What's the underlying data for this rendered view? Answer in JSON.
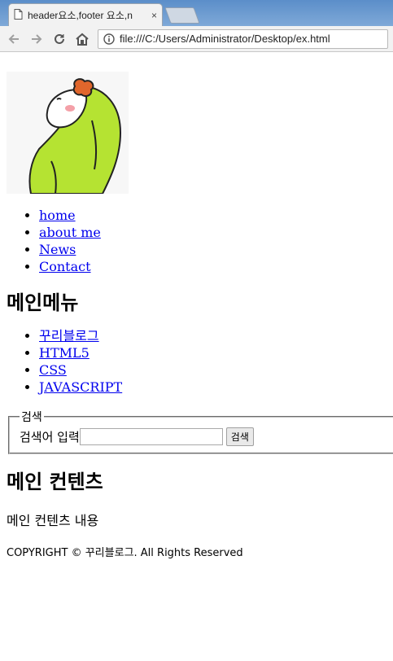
{
  "browser": {
    "tab_title": "header요소,footer 요소,n",
    "tab_close": "×",
    "url": "file:///C:/Users/Administrator/Desktop/ex.html"
  },
  "header": {
    "nav": [
      {
        "label": "home"
      },
      {
        "label": "about me"
      },
      {
        "label": "News"
      },
      {
        "label": "Contact"
      }
    ]
  },
  "aside": {
    "title": "메인메뉴",
    "menu": [
      {
        "label": "꾸리블로그"
      },
      {
        "label": "HTML5"
      },
      {
        "label": "CSS"
      },
      {
        "label": "JAVASCRIPT"
      }
    ],
    "search": {
      "legend": "검색",
      "label": "검색어 입력",
      "value": "",
      "button": "검색"
    }
  },
  "main": {
    "title": "메인 컨텐츠",
    "text": "메인 컨텐츠 내용"
  },
  "footer": {
    "copyright": "COPYRIGHT © 꾸리블로그. All Rights Reserved"
  },
  "colors": {
    "link": "#0000ee",
    "hood": "#b5e332",
    "hair": "#e0662c"
  }
}
